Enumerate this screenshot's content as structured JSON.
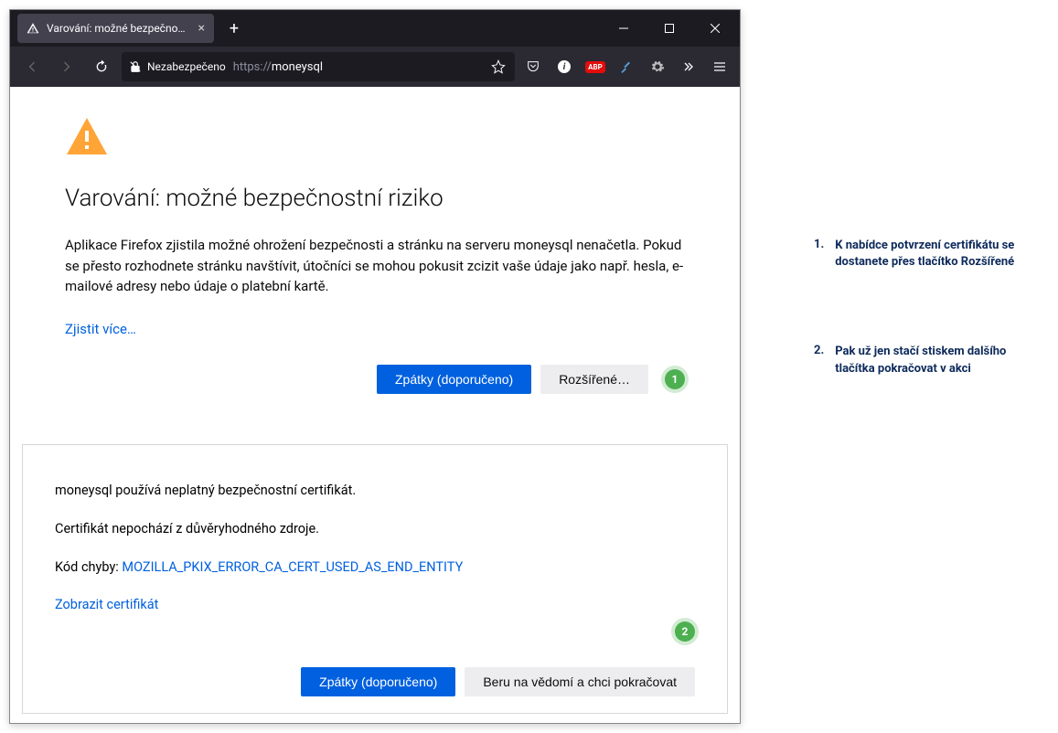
{
  "tab": {
    "title": "Varování: možné bezpečností r"
  },
  "urlbar": {
    "security_label": "Nezabezpečeno",
    "url_scheme": "https://",
    "url_host": "moneysql"
  },
  "page": {
    "title": "Varování: možné bezpečnostní riziko",
    "body": "Aplikace Firefox zjistila možné ohrožení bezpečnosti a stránku na serveru moneysql nenačetla. Pokud se přesto rozhodnete stránku navštívit, útočníci se mohou pokusit zcizit vaše údaje jako např. hesla, e-mailové adresy nebo údaje o platební kartě.",
    "learn_more": "Zjistit více…",
    "btn_back": "Zpátky (doporučeno)",
    "btn_advanced": "Rozšířené…"
  },
  "details": {
    "line1": "moneysql používá neplatný bezpečnostní certifikát.",
    "line2": "Certifikát nepochází z důvěryhodného zdroje.",
    "error_label": "Kód chyby: ",
    "error_code": "MOZILLA_PKIX_ERROR_CA_CERT_USED_AS_END_ENTITY",
    "view_cert": "Zobrazit certifikát",
    "btn_back": "Zpátky (doporučeno)",
    "btn_accept": "Beru na vědomí a chci pokračovat"
  },
  "callouts": {
    "c1": "1",
    "c2": "2"
  },
  "annotations": {
    "a1_num": "1.",
    "a1_text": "K nabídce potvrzení certifikátu se dostanete přes tlačítko Rozšířené",
    "a2_num": "2.",
    "a2_text": "Pak už jen stačí stiskem dalšího tlačítka pokračovat v akci"
  }
}
